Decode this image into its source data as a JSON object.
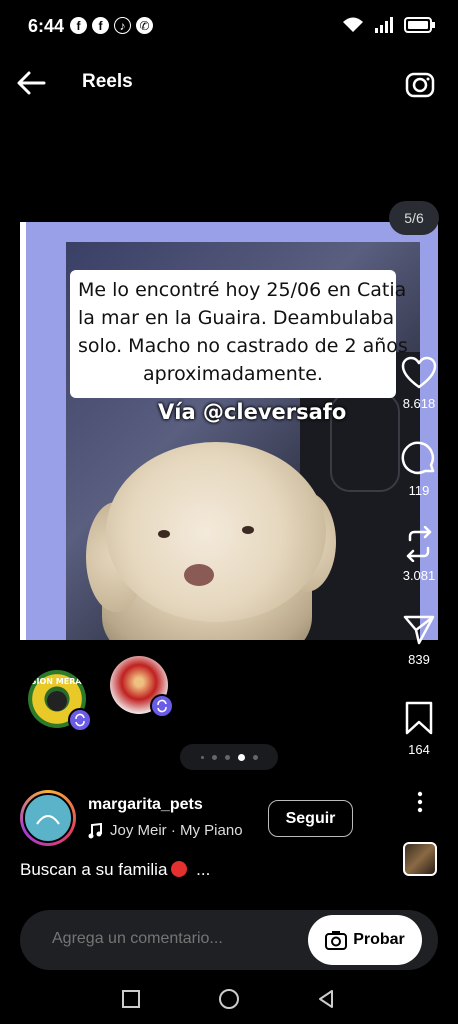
{
  "status_bar": {
    "time": "6:44",
    "app_icons": [
      "facebook-messenger-icon",
      "facebook-icon",
      "tiktok-icon",
      "whatsapp-icon"
    ]
  },
  "header": {
    "title": "Reels"
  },
  "post": {
    "carousel_counter": "5/6",
    "image_text_lines": [
      "Me lo encontré hoy 25/06 en Catia",
      "la mar en la Guaira. Deambulaba",
      "solo. Macho no castrado de 2 años",
      "aproximadamente."
    ],
    "image_watermark": "Vía @cleversafo",
    "current_slide": 4,
    "total_dots": 5,
    "collaborator_badges": [
      "MISION MERAKO"
    ]
  },
  "actions": {
    "likes": "8.618",
    "comments": "119",
    "reposts": "3.081",
    "shares": "839",
    "saves": "164"
  },
  "author": {
    "username": "margarita_pets",
    "music": "Joy Meir · My Piano",
    "follow_label": "Seguir"
  },
  "caption": {
    "text": "Buscan a su familia",
    "more": "..."
  },
  "comment_bar": {
    "placeholder": "Agrega un comentario...",
    "try_label": "Probar"
  },
  "colors": {
    "background": "#000000",
    "slide_frame": "#9aa0e8",
    "collab_badge": "#6b5ce7",
    "red_dot": "#e53030"
  }
}
